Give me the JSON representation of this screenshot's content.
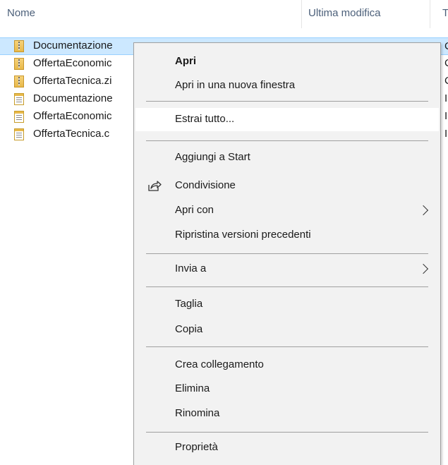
{
  "explorer": {
    "columns": {
      "name": "Nome",
      "modified": "Ultima modifica",
      "extra": "T"
    },
    "files": [
      {
        "name": "Documentazione",
        "icon": "zip-folder-icon",
        "edge": "C",
        "selected": true
      },
      {
        "name": "OffertaEconomic",
        "icon": "zip-folder-icon",
        "edge": "C",
        "selected": false
      },
      {
        "name": "OffertaTecnica.zi",
        "icon": "zip-folder-icon",
        "edge": "C",
        "selected": false
      },
      {
        "name": "Documentazione",
        "icon": "document-icon",
        "edge": "I",
        "selected": false
      },
      {
        "name": "OffertaEconomic",
        "icon": "document-icon",
        "edge": "I",
        "selected": false
      },
      {
        "name": "OffertaTecnica.c",
        "icon": "document-icon",
        "edge": "I",
        "selected": false
      }
    ]
  },
  "context_menu": {
    "open": "Apri",
    "open_new_window": "Apri in una nuova finestra",
    "extract_all": "Estrai tutto...",
    "pin_to_start": "Aggiungi a Start",
    "share": "Condivisione",
    "open_with": "Apri con",
    "restore_previous": "Ripristina versioni precedenti",
    "send_to": "Invia a",
    "cut": "Taglia",
    "copy": "Copia",
    "create_shortcut": "Crea collegamento",
    "delete": "Elimina",
    "rename": "Rinomina",
    "properties": "Proprietà"
  },
  "colors": {
    "selection_bg": "#cce8ff",
    "selection_border": "#99d1ff",
    "menu_bg": "#f2f2f2",
    "menu_hover": "#ffffff",
    "header_text": "#4c607a"
  }
}
